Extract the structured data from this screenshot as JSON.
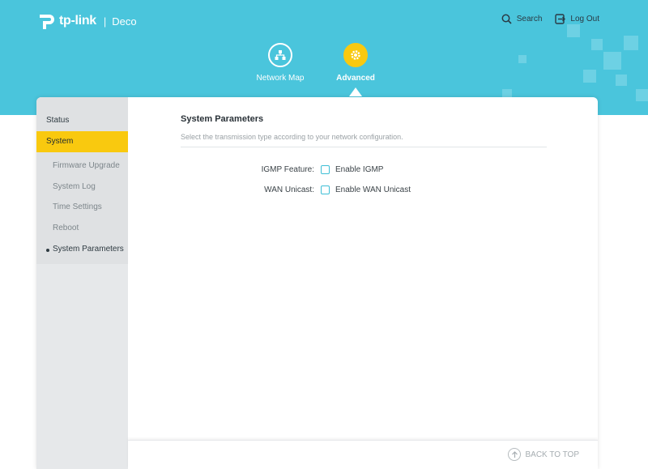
{
  "header": {
    "brand": "tp-link",
    "product": "Deco",
    "search_label": "Search",
    "logout_label": "Log Out",
    "nav": [
      {
        "label": "Network Map",
        "icon": "network-map-icon"
      },
      {
        "label": "Advanced",
        "icon": "advanced-gear-icon"
      }
    ]
  },
  "sidebar": {
    "status_label": "Status",
    "system_label": "System",
    "items": [
      {
        "label": "Firmware Upgrade"
      },
      {
        "label": "System Log"
      },
      {
        "label": "Time Settings"
      },
      {
        "label": "Reboot"
      },
      {
        "label": "System Parameters"
      }
    ]
  },
  "main": {
    "title": "System Parameters",
    "description": "Select the transmission type according to your network configuration.",
    "fields": [
      {
        "label": "IGMP Feature:",
        "option": "Enable IGMP",
        "checked": false
      },
      {
        "label": "WAN Unicast:",
        "option": "Enable WAN Unicast",
        "checked": false
      }
    ]
  },
  "footer": {
    "back_to_top": "BACK TO TOP"
  },
  "colors": {
    "header_bg": "#4ac5dc",
    "accent_yellow": "#f9c90f",
    "checkbox_border": "#3fbfd6"
  }
}
